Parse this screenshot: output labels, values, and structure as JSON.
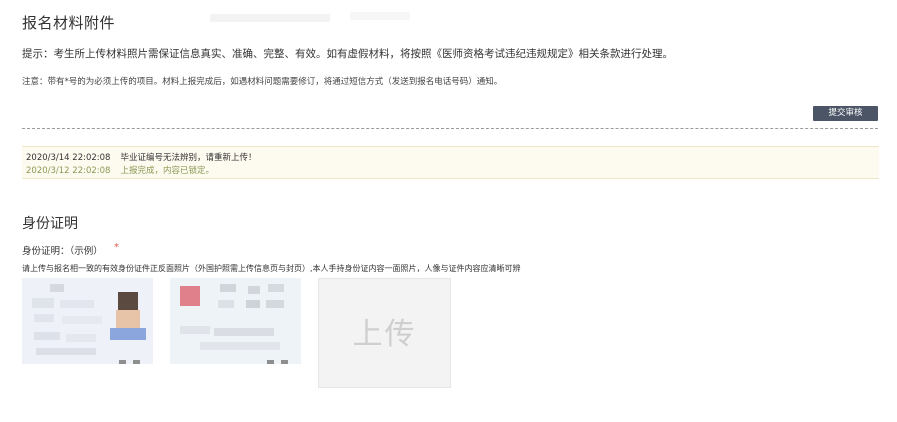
{
  "section1": {
    "title": "报名材料附件",
    "tip": "提示：考生所上传材料照片需保证信息真实、准确、完整、有效。如有虚假材料，将按照《医师资格考试违纪违规规定》相关条款进行处理。",
    "note": "注意：带有*号的为必须上传的项目。材料上报完成后，如遇材料问题需要修订，将通过短信方式（发送到报名电话号码）通知。",
    "submit_label": "提交审核"
  },
  "log": [
    {
      "time": "2020/3/14 22:02:08",
      "message": "毕业证编号无法辨别，请重新上传！",
      "color": "#333333"
    },
    {
      "time": "2020/3/12 22:02:08",
      "message": "上报完成，内容已锁定。",
      "color": "#8a9a52"
    }
  ],
  "section2": {
    "title": "身份证明",
    "field_label": "身份证明：",
    "example_label": "（示例）",
    "required_mark": "*",
    "description": "请上传与报名相一致的有效身份证件正反面照片（外国护照需上传信息页与封页）,本人手持身份证内容一面照片，人像与证件内容应清晰可辨",
    "upload_label": "上传",
    "accent_required": "#e05a4a",
    "button_color": "#4b5566"
  }
}
